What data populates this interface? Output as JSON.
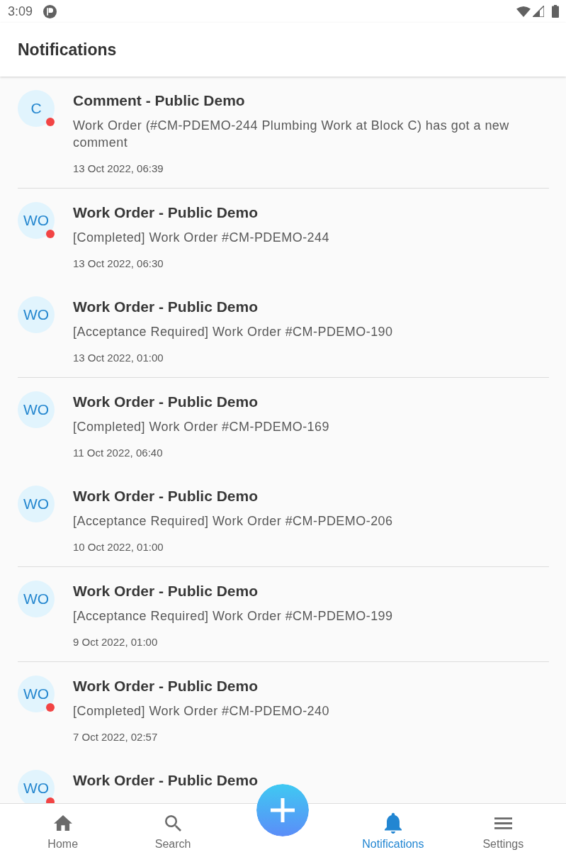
{
  "status_bar": {
    "time": "3:09"
  },
  "header": {
    "title": "Notifications"
  },
  "notifications": [
    {
      "avatar": "C",
      "unread": true,
      "title": "Comment - Public Demo",
      "message": "Work Order (#CM-PDEMO-244 Plumbing Work at Block C) has got a new comment",
      "date": "13 Oct 2022, 06:39",
      "divider": true
    },
    {
      "avatar": "WO",
      "unread": true,
      "title": "Work Order - Public Demo",
      "message": "[Completed] Work Order #CM-PDEMO-244",
      "date": "13 Oct 2022, 06:30",
      "divider": false
    },
    {
      "avatar": "WO",
      "unread": false,
      "title": "Work Order - Public Demo",
      "message": "[Acceptance Required] Work Order #CM-PDEMO-190",
      "date": "13 Oct 2022, 01:00",
      "divider": true
    },
    {
      "avatar": "WO",
      "unread": false,
      "title": "Work Order - Public Demo",
      "message": "[Completed] Work Order #CM-PDEMO-169",
      "date": "11 Oct 2022, 06:40",
      "divider": false
    },
    {
      "avatar": "WO",
      "unread": false,
      "title": "Work Order - Public Demo",
      "message": "[Acceptance Required] Work Order #CM-PDEMO-206",
      "date": "10 Oct 2022, 01:00",
      "divider": true
    },
    {
      "avatar": "WO",
      "unread": false,
      "title": "Work Order - Public Demo",
      "message": "[Acceptance Required] Work Order #CM-PDEMO-199",
      "date": "9 Oct 2022, 01:00",
      "divider": true
    },
    {
      "avatar": "WO",
      "unread": true,
      "title": "Work Order - Public Demo",
      "message": "[Completed] Work Order #CM-PDEMO-240",
      "date": "7 Oct 2022, 02:57",
      "divider": false
    },
    {
      "avatar": "WO",
      "unread": true,
      "title": "Work Order - Public Demo",
      "divider": false
    }
  ],
  "bottom_nav": {
    "tabs": [
      {
        "kind": "home",
        "label": "Home",
        "selected": false
      },
      {
        "kind": "search",
        "label": "Search",
        "selected": false
      },
      {
        "kind": "bell",
        "label": "Notifications",
        "selected": true
      },
      {
        "kind": "menu",
        "label": "Settings",
        "selected": false
      }
    ],
    "fab": {
      "kind": "add"
    }
  }
}
